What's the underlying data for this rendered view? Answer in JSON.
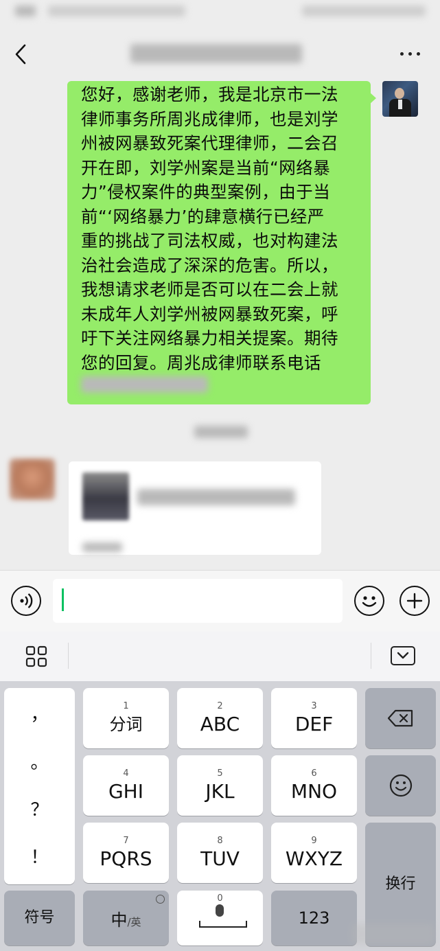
{
  "chat": {
    "message_text": "您好，感谢老师，我是北京市一法\n律师事务所周兆成律师，也是刘学\n州被网暴致死案代理律师，二会召\n开在即，刘学州案是当前“网络暴\n力”侵权案件的典型案例，由于当\n前“‘网络暴力’的肆意横行已经严\n重的挑战了司法权威，也对构建法\n治社会造成了深深的危害。所以，\n我想请求老师是否可以在二会上就\n未成年人刘学州被网暴致死案，呼\n吁下关注网络暴力相关提案。期待\n您的回复。周兆成律师联系电话"
  },
  "input": {
    "value": ""
  },
  "keyboard": {
    "punctuation": [
      "，",
      "。",
      "？",
      "！"
    ],
    "keys": [
      {
        "num": "1",
        "label": "分词"
      },
      {
        "num": "2",
        "label": "ABC"
      },
      {
        "num": "3",
        "label": "DEF"
      },
      {
        "num": "4",
        "label": "GHI"
      },
      {
        "num": "5",
        "label": "JKL"
      },
      {
        "num": "6",
        "label": "MNO"
      },
      {
        "num": "7",
        "label": "PQRS"
      },
      {
        "num": "8",
        "label": "TUV"
      },
      {
        "num": "9",
        "label": "WXYZ"
      }
    ],
    "symbols_label": "符号",
    "lang_main": "中",
    "lang_alt": "/英",
    "space_num": "0",
    "num_label": "123",
    "enter_label": "换行"
  },
  "icons": {
    "back": "chevron-left-icon",
    "more": "ellipsis-icon",
    "voice": "voice-icon",
    "emoji": "emoji-icon",
    "plus": "plus-icon",
    "backspace": "backspace-icon",
    "keyboard_emoji": "smiley-icon"
  },
  "colors": {
    "bubble": "#95ec69",
    "caret": "#07c160",
    "background": "#ededed"
  }
}
